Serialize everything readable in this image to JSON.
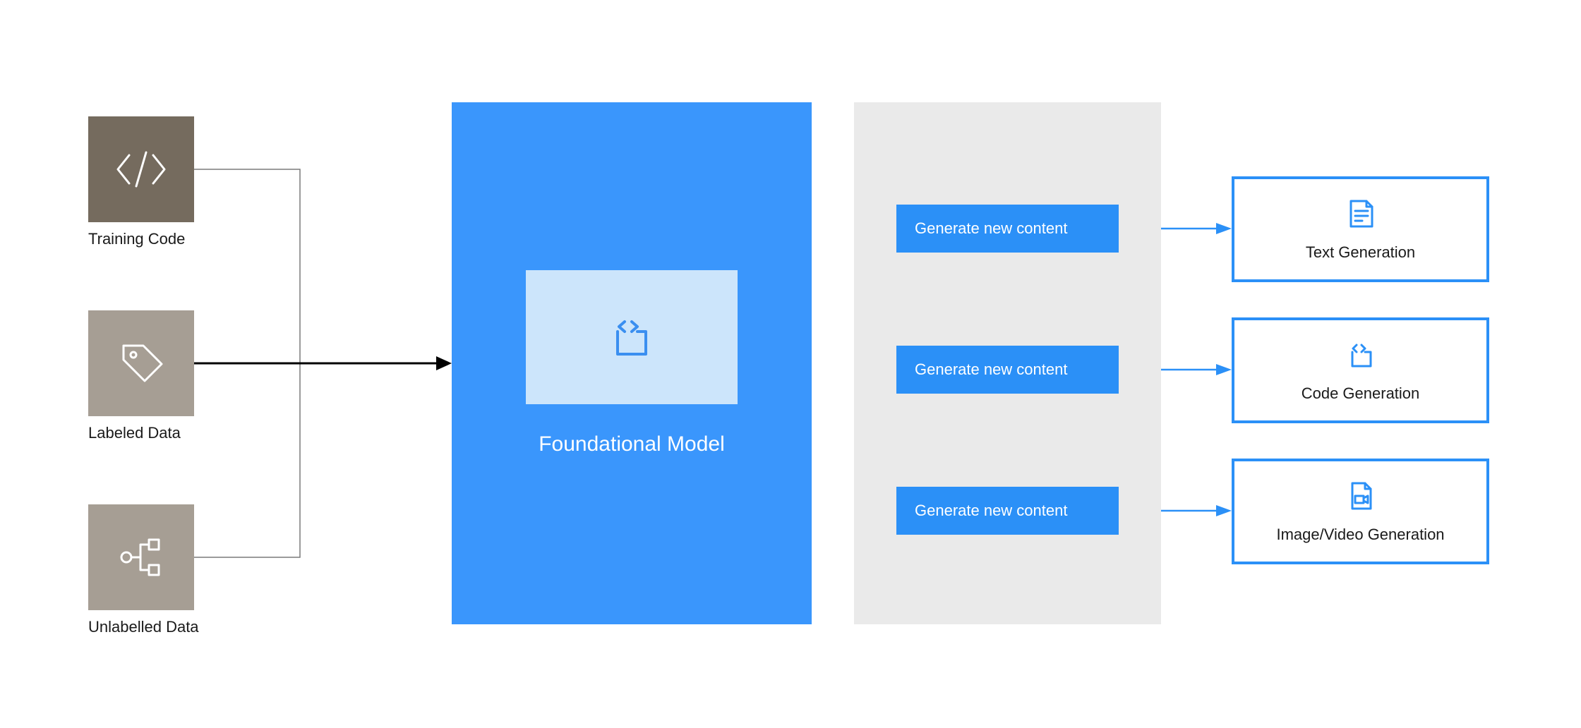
{
  "colors": {
    "brown_dark": "#756b5e",
    "brown_light": "#a69e94",
    "blue_primary": "#3a96fc",
    "blue_button": "#2b90f7",
    "blue_light": "#cce5fb",
    "gray_panel": "#eaeaea",
    "text": "#1a1a1a",
    "white": "#ffffff"
  },
  "inputs": [
    {
      "label": "Training Code",
      "icon": "code-icon"
    },
    {
      "label": "Labeled Data",
      "icon": "tag-icon"
    },
    {
      "label": "Unlabelled Data",
      "icon": "hierarchy-icon"
    }
  ],
  "center": {
    "label": "Foundational Model",
    "icon": "code-embed-icon"
  },
  "generate_buttons": [
    {
      "label": "Generate new content"
    },
    {
      "label": "Generate new content"
    },
    {
      "label": "Generate new content"
    }
  ],
  "outputs": [
    {
      "label": "Text Generation",
      "icon": "document-icon"
    },
    {
      "label": "Code Generation",
      "icon": "code-embed-icon"
    },
    {
      "label": "Image/Video Generation",
      "icon": "video-file-icon"
    }
  ]
}
